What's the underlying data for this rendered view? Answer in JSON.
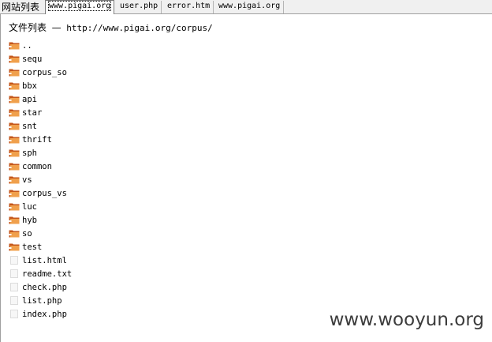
{
  "tabbar": {
    "site_label": "网站列表",
    "tabs": [
      {
        "label": "www.pigai.org",
        "active": true
      },
      {
        "label": "user.php",
        "active": false
      },
      {
        "label": "error.htm",
        "active": false
      },
      {
        "label": "www.pigai.org",
        "active": false
      }
    ]
  },
  "listing": {
    "title_prefix": "文件列表",
    "title_sep": "—",
    "path": "http://www.pigai.org/corpus/",
    "entries": [
      {
        "name": "..",
        "type": "folder",
        "icon": "folder-icon"
      },
      {
        "name": "sequ",
        "type": "folder",
        "icon": "folder-icon"
      },
      {
        "name": "corpus_so",
        "type": "folder",
        "icon": "folder-icon"
      },
      {
        "name": "bbx",
        "type": "folder",
        "icon": "folder-icon"
      },
      {
        "name": "api",
        "type": "folder",
        "icon": "folder-icon"
      },
      {
        "name": "star",
        "type": "folder",
        "icon": "folder-icon"
      },
      {
        "name": "snt",
        "type": "folder",
        "icon": "folder-icon"
      },
      {
        "name": "thrift",
        "type": "folder",
        "icon": "folder-icon"
      },
      {
        "name": "sph",
        "type": "folder",
        "icon": "folder-icon"
      },
      {
        "name": "common",
        "type": "folder",
        "icon": "folder-icon"
      },
      {
        "name": "vs",
        "type": "folder",
        "icon": "folder-icon"
      },
      {
        "name": "corpus_vs",
        "type": "folder",
        "icon": "folder-icon"
      },
      {
        "name": "luc",
        "type": "folder",
        "icon": "folder-icon"
      },
      {
        "name": "hyb",
        "type": "folder",
        "icon": "folder-icon"
      },
      {
        "name": "so",
        "type": "folder",
        "icon": "folder-icon"
      },
      {
        "name": "test",
        "type": "folder",
        "icon": "folder-icon"
      },
      {
        "name": "list.html",
        "type": "file",
        "icon": "file-icon"
      },
      {
        "name": "readme.txt",
        "type": "file",
        "icon": "file-icon"
      },
      {
        "name": "check.php",
        "type": "file",
        "icon": "file-icon"
      },
      {
        "name": "list.php",
        "type": "file",
        "icon": "file-icon"
      },
      {
        "name": "index.php",
        "type": "file",
        "icon": "file-icon"
      }
    ]
  },
  "watermark": {
    "text": "www.wooyun.org"
  },
  "colors": {
    "folder_dark": "#c4561a",
    "folder_light": "#f0a04c",
    "tab_background": "#f0f0f0",
    "border": "#a0a0a0",
    "watermark": "#3c3c3c"
  }
}
